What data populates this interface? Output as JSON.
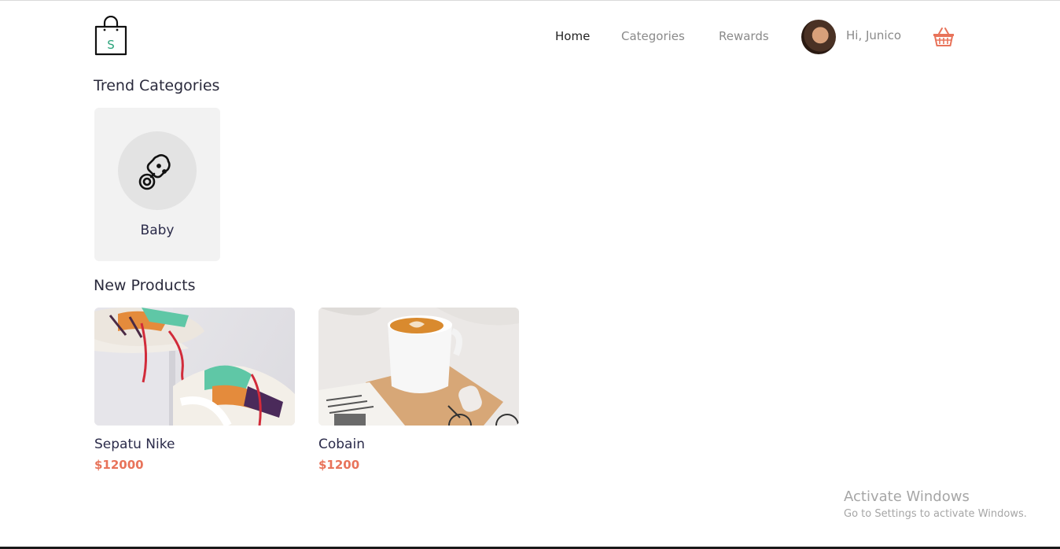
{
  "header": {
    "logo_letter": "S",
    "nav": {
      "home": "Home",
      "categories": "Categories",
      "rewards": "Rewards"
    },
    "user": {
      "greeting": "Hi, Junico"
    },
    "icons": {
      "logo": "shopping-bag-icon",
      "cart": "basket-icon"
    }
  },
  "trend": {
    "title": "Trend Categories",
    "categories": [
      {
        "label": "Baby",
        "icon": "pacifier-icon"
      }
    ]
  },
  "new_products": {
    "title": "New Products",
    "items": [
      {
        "name": "Sepatu Nike",
        "price": "$12000"
      },
      {
        "name": "Cobain",
        "price": "$1200"
      }
    ]
  },
  "watermark": {
    "line1": "Activate Windows",
    "line2": "Go to Settings to activate Windows."
  },
  "colors": {
    "accent": "#e8735a",
    "logo_letter": "#2aa37a",
    "card_bg": "#f2f2f2"
  }
}
